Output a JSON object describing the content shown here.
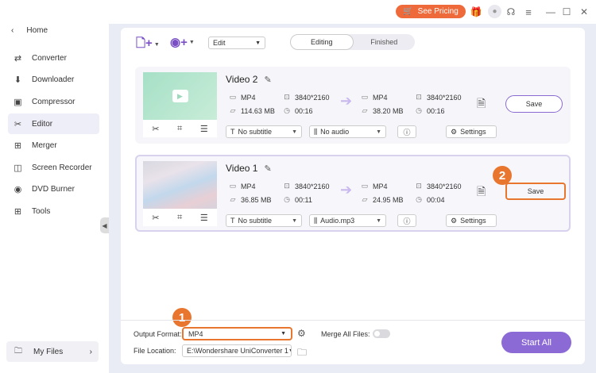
{
  "topbar": {
    "pricing_label": "See Pricing",
    "icons": [
      "cart-icon",
      "gift-icon",
      "avatar",
      "support-icon",
      "menu-icon",
      "minimize-icon",
      "maximize-icon",
      "close-icon"
    ]
  },
  "sidebar": {
    "home_label": "Home",
    "items": [
      {
        "label": "Converter",
        "icon": "converter-icon"
      },
      {
        "label": "Downloader",
        "icon": "downloader-icon"
      },
      {
        "label": "Compressor",
        "icon": "compressor-icon"
      },
      {
        "label": "Editor",
        "icon": "editor-icon",
        "active": true
      },
      {
        "label": "Merger",
        "icon": "merger-icon"
      },
      {
        "label": "Screen Recorder",
        "icon": "screen-recorder-icon"
      },
      {
        "label": "DVD Burner",
        "icon": "dvd-burner-icon"
      },
      {
        "label": "Tools",
        "icon": "tools-icon"
      }
    ],
    "myfiles_label": "My Files"
  },
  "toolbar": {
    "edit_select": "Edit",
    "tabs": [
      "Editing",
      "Finished"
    ]
  },
  "videos": [
    {
      "title": "Video 2",
      "src_format": "MP4",
      "src_res": "3840*2160",
      "src_size": "114.63 MB",
      "src_dur": "00:16",
      "out_format": "MP4",
      "out_res": "3840*2160",
      "out_size": "38.20 MB",
      "out_dur": "00:16",
      "subtitle": "No subtitle",
      "audio": "No audio",
      "settings": "Settings",
      "save": "Save"
    },
    {
      "title": "Video 1",
      "src_format": "MP4",
      "src_res": "3840*2160",
      "src_size": "36.85 MB",
      "src_dur": "00:11",
      "out_format": "MP4",
      "out_res": "3840*2160",
      "out_size": "24.95 MB",
      "out_dur": "00:04",
      "subtitle": "No subtitle",
      "audio": "Audio.mp3",
      "settings": "Settings",
      "save": "Save"
    }
  ],
  "callouts": [
    "1",
    "2"
  ],
  "bottom": {
    "output_format_label": "Output Format:",
    "output_format_value": "MP4",
    "merge_label": "Merge All Files:",
    "file_location_label": "File Location:",
    "file_location_value": "E:\\Wondershare UniConverter 1",
    "start_all": "Start All"
  }
}
